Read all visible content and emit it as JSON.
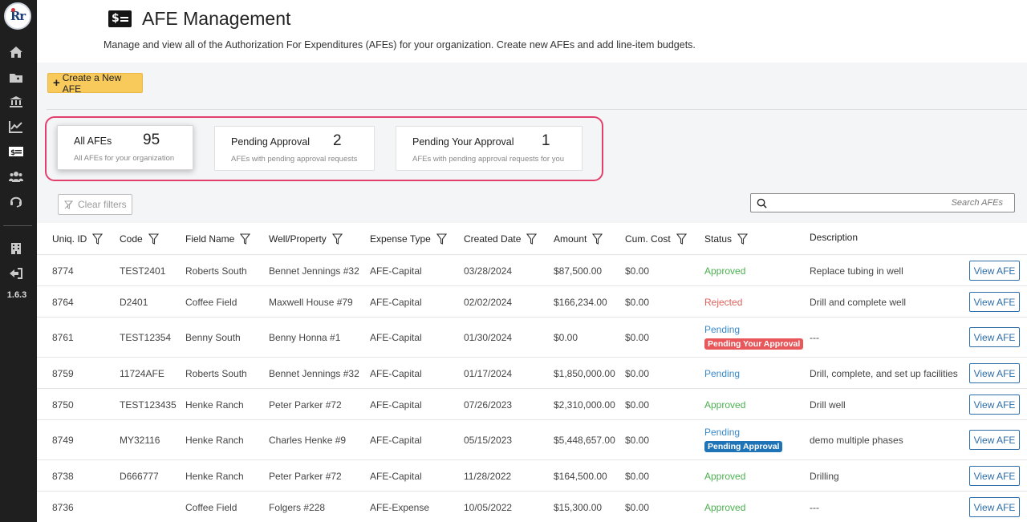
{
  "app": {
    "logo_text": "Rr",
    "version": "1.6.3",
    "sidebar_icons": [
      "home-icon",
      "folder-icon",
      "bank-icon",
      "chart-line-icon",
      "money-bill-icon",
      "users-icon",
      "headset-icon",
      "building-icon",
      "sign-out-icon"
    ]
  },
  "header": {
    "icon": "money-bill-icon",
    "icon_text": "$",
    "title": "AFE Management",
    "description": "Manage and view all of the Authorization For Expenditures (AFEs) for your organization. Create new AFEs and add line-item budgets."
  },
  "toolbar": {
    "create_prefix": "+",
    "create_label": "Create a New AFE"
  },
  "summary_cards": [
    {
      "title": "All AFEs",
      "count": "95",
      "subtitle": "All AFEs for your organization",
      "active": true
    },
    {
      "title": "Pending Approval",
      "count": "2",
      "subtitle": "AFEs with pending approval requests",
      "active": false
    },
    {
      "title": "Pending Your Approval",
      "count": "1",
      "subtitle": "AFEs with pending approval requests for you",
      "active": false
    }
  ],
  "filters": {
    "clear_label": "Clear filters",
    "search_placeholder": "Search AFEs"
  },
  "table": {
    "columns": [
      "Uniq. ID",
      "Code",
      "Field Name",
      "Well/Property",
      "Expense Type",
      "Created Date",
      "Amount",
      "Cum. Cost",
      "Status",
      "Description"
    ],
    "view_label": "View AFE",
    "rows": [
      {
        "id": "8774",
        "code": "TEST2401",
        "field": "Roberts South",
        "well": "Bennet Jennings #32",
        "type": "AFE-Capital",
        "date": "03/28/2024",
        "amount": "$87,500.00",
        "cum": "$0.00",
        "status": "Approved",
        "badge": "",
        "description": "Replace tubing in well"
      },
      {
        "id": "8764",
        "code": "D2401",
        "field": "Coffee Field",
        "well": "Maxwell House #79",
        "type": "AFE-Capital",
        "date": "02/02/2024",
        "amount": "$166,234.00",
        "cum": "$0.00",
        "status": "Rejected",
        "badge": "",
        "description": "Drill and complete well"
      },
      {
        "id": "8761",
        "code": "TEST12354",
        "field": "Benny South",
        "well": "Benny Honna #1",
        "type": "AFE-Capital",
        "date": "01/30/2024",
        "amount": "$0.00",
        "cum": "$0.00",
        "status": "Pending",
        "badge": "Pending Your Approval",
        "description": "---"
      },
      {
        "id": "8759",
        "code": "11724AFE",
        "field": "Roberts South",
        "well": "Bennet Jennings #32",
        "type": "AFE-Capital",
        "date": "01/17/2024",
        "amount": "$1,850,000.00",
        "cum": "$0.00",
        "status": "Pending",
        "badge": "",
        "description": "Drill, complete, and set up facilities"
      },
      {
        "id": "8750",
        "code": "TEST123435",
        "field": "Henke Ranch",
        "well": "Peter Parker #72",
        "type": "AFE-Capital",
        "date": "07/26/2023",
        "amount": "$2,310,000.00",
        "cum": "$0.00",
        "status": "Approved",
        "badge": "",
        "description": "Drill well"
      },
      {
        "id": "8749",
        "code": "MY32116",
        "field": "Henke Ranch",
        "well": "Charles Henke #9",
        "type": "AFE-Capital",
        "date": "05/15/2023",
        "amount": "$5,448,657.00",
        "cum": "$0.00",
        "status": "Pending",
        "badge": "Pending Approval",
        "description": "demo multiple phases"
      },
      {
        "id": "8738",
        "code": "D666777",
        "field": "Henke Ranch",
        "well": "Peter Parker #72",
        "type": "AFE-Capital",
        "date": "11/28/2022",
        "amount": "$164,500.00",
        "cum": "$0.00",
        "status": "Approved",
        "badge": "",
        "description": "Drilling"
      },
      {
        "id": "8736",
        "code": "",
        "field": "Coffee Field",
        "well": "Folgers #228",
        "type": "AFE-Expense",
        "date": "10/05/2022",
        "amount": "$15,300.00",
        "cum": "$0.00",
        "status": "Approved",
        "badge": "",
        "description": "---"
      }
    ]
  },
  "colors": {
    "sidebar": "#1f1f1f",
    "create_button": "#f8c95b",
    "highlight": "#e2406c",
    "approved": "#4caf50",
    "rejected": "#e0605a",
    "pending": "#3a89c9",
    "badge_your_approval": "#e8575a",
    "badge_pending_approval": "#1f74b8"
  }
}
